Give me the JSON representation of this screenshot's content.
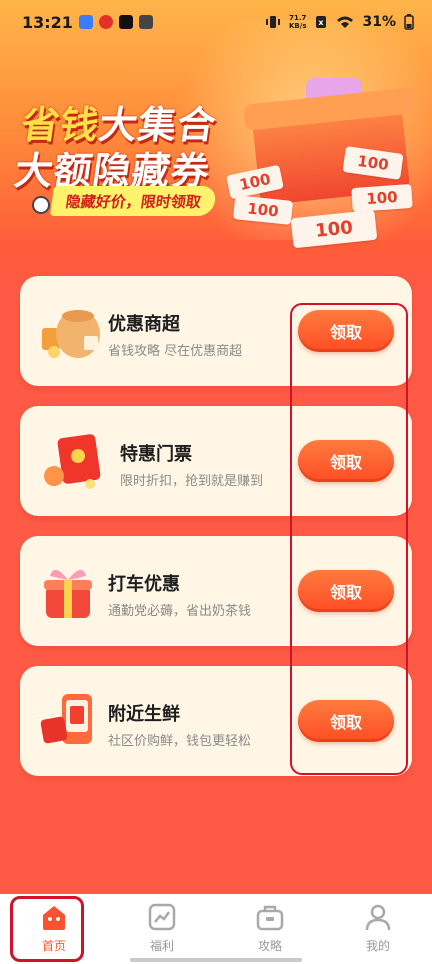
{
  "status_bar": {
    "time": "13:21",
    "net_speed_value": "71.7",
    "net_speed_unit": "KB/s",
    "battery": "31%"
  },
  "banner": {
    "title_line1_a": "省钱",
    "title_line1_b": "大集合",
    "title_line2": "大额隐藏券",
    "tag": "隐藏好价，限时领取",
    "ticket_value": "100"
  },
  "cards": [
    {
      "title": "优惠商超",
      "desc": "省钱攻略  尽在优惠商超",
      "button": "领取",
      "icon": "grain-bag-icon"
    },
    {
      "title": "特惠门票",
      "desc": "限时折扣，抢到就是赚到",
      "button": "领取",
      "icon": "red-envelope-icon"
    },
    {
      "title": "打车优惠",
      "desc": "通勤党必薅，省出奶茶钱",
      "button": "领取",
      "icon": "gift-box-icon"
    },
    {
      "title": "附近生鲜",
      "desc": "社区价购鲜，钱包更轻松",
      "button": "领取",
      "icon": "phone-coupon-icon"
    }
  ],
  "tabs": [
    {
      "label": "首页",
      "icon": "home-icon",
      "active": true
    },
    {
      "label": "福利",
      "icon": "chart-icon",
      "active": false
    },
    {
      "label": "攻略",
      "icon": "toolbox-icon",
      "active": false
    },
    {
      "label": "我的",
      "icon": "user-icon",
      "active": false
    }
  ],
  "colors": {
    "background": "#fe5a45",
    "button": "#ff5a2a",
    "accent": "#ff5a30",
    "highlight": "#d4112a"
  }
}
